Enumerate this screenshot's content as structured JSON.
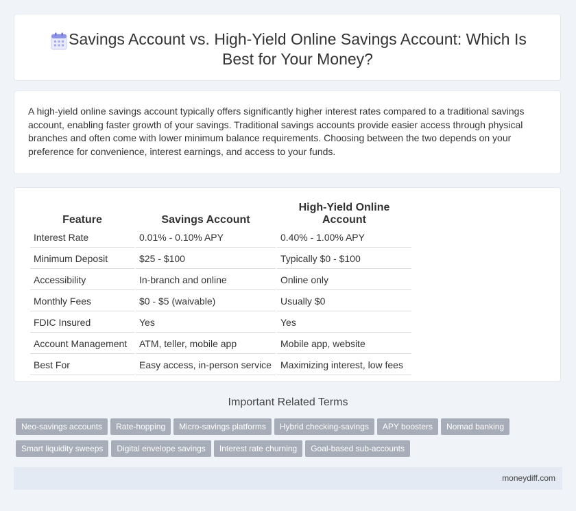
{
  "header": {
    "title": "Savings Account vs. High-Yield Online Savings Account: Which Is Best for Your Money?",
    "icon": "calendar-icon"
  },
  "intro": {
    "text": "A high-yield online savings account typically offers significantly higher interest rates compared to a traditional savings account, enabling faster growth of your savings. Traditional savings accounts provide easier access through physical branches and often come with lower minimum balance requirements. Choosing between the two depends on your preference for convenience, interest earnings, and access to your funds."
  },
  "table": {
    "headers": [
      "Feature",
      "Savings Account",
      "High-Yield Online Account"
    ],
    "rows": [
      [
        "Interest Rate",
        "0.01% - 0.10% APY",
        "0.40% - 1.00% APY"
      ],
      [
        "Minimum Deposit",
        "$25 - $100",
        "Typically $0 - $100"
      ],
      [
        "Accessibility",
        "In-branch and online",
        "Online only"
      ],
      [
        "Monthly Fees",
        "$0 - $5 (waivable)",
        "Usually $0"
      ],
      [
        "FDIC Insured",
        "Yes",
        "Yes"
      ],
      [
        "Account Management",
        "ATM, teller, mobile app",
        "Mobile app, website"
      ],
      [
        "Best For",
        "Easy access, in-person service",
        "Maximizing interest, low fees"
      ]
    ]
  },
  "related": {
    "title": "Important Related Terms",
    "tags": [
      "Neo-savings accounts",
      "Rate-hopping",
      "Micro-savings platforms",
      "Hybrid checking-savings",
      "APY boosters",
      "Nomad banking",
      "Smart liquidity sweeps",
      "Digital envelope savings",
      "Interest rate churning",
      "Goal-based sub-accounts"
    ]
  },
  "footer": {
    "brand": "moneydiff.com"
  },
  "colors": {
    "background": "#f0f3f8",
    "tag": "#a7adb8",
    "footer": "#e4eaf3",
    "icon_accent": "#6f77d9"
  }
}
